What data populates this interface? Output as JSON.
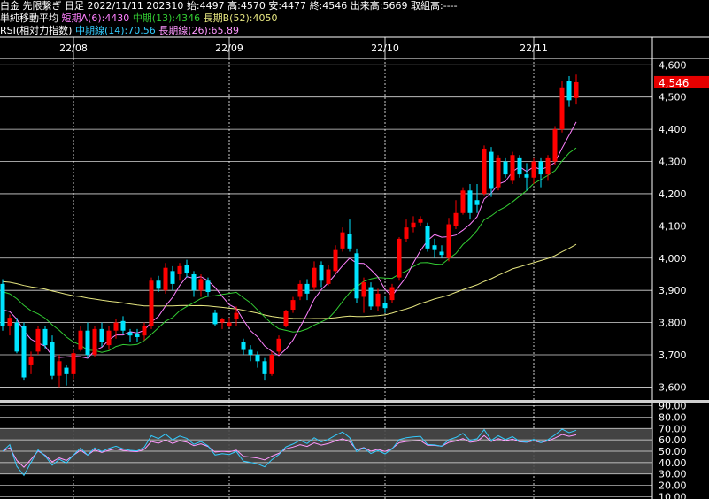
{
  "header": {
    "instrument": "白金 先限繋ぎ 日足",
    "date": "2022/11/11",
    "contract": "202310",
    "open_label": "始:",
    "open": "4497",
    "high_label": "高:",
    "high": "4570",
    "low_label": "安:",
    "low": "4477",
    "close_label": "終:",
    "close": "4546",
    "volume_label": "出来高:",
    "volume": "5669",
    "oi_label": "取組高:",
    "oi": "----",
    "ma_title": "単純移動平均",
    "ma_short_label": "短期A(6):",
    "ma_short": "4430",
    "ma_mid_label": "中期(13):",
    "ma_mid": "4346",
    "ma_long_label": "長期B(52):",
    "ma_long": "4050",
    "rsi_title": "RSI(相対力指数)",
    "rsi_mid_label": "中期線(14):",
    "rsi_mid": "70.56",
    "rsi_long_label": "長期線(26):",
    "rsi_long": "65.89"
  },
  "colors": {
    "up": "#ff0000",
    "down": "#00e5ff",
    "ma_short": "#ff80ff",
    "ma_mid": "#33cc33",
    "ma_long": "#e6e680",
    "rsi_mid": "#33ccff",
    "rsi_long": "#ff99ff",
    "last_price_bg": "#e60000"
  },
  "chart_data": [
    {
      "type": "candlestick",
      "x_tick_labels": [
        "22/08",
        "22/09",
        "22/10",
        "22/11"
      ],
      "x_tick_index": [
        10,
        32,
        54,
        75
      ],
      "y_ticks": [
        3600,
        3700,
        3800,
        3900,
        4000,
        4100,
        4200,
        4300,
        4400,
        4500,
        4600
      ],
      "y_tick_labels": [
        "3,600",
        "3,700",
        "3,800",
        "3,900",
        "4,000",
        "4,100",
        "4,200",
        "4,300",
        "4,400",
        "4,500",
        "4,600"
      ],
      "ylim": [
        3560,
        4620
      ],
      "last_price": 4546,
      "last_price_label": "4,546",
      "candles": [
        {
          "o": 3920,
          "h": 3935,
          "l": 3775,
          "c": 3790
        },
        {
          "o": 3790,
          "h": 3825,
          "l": 3760,
          "c": 3815
        },
        {
          "o": 3800,
          "h": 3815,
          "l": 3705,
          "c": 3710
        },
        {
          "o": 3790,
          "h": 3800,
          "l": 3620,
          "c": 3630
        },
        {
          "o": 3670,
          "h": 3710,
          "l": 3640,
          "c": 3695
        },
        {
          "o": 3710,
          "h": 3790,
          "l": 3700,
          "c": 3780
        },
        {
          "o": 3780,
          "h": 3790,
          "l": 3720,
          "c": 3730
        },
        {
          "o": 3740,
          "h": 3760,
          "l": 3625,
          "c": 3635
        },
        {
          "o": 3635,
          "h": 3700,
          "l": 3600,
          "c": 3680
        },
        {
          "o": 3660,
          "h": 3670,
          "l": 3605,
          "c": 3640
        },
        {
          "o": 3640,
          "h": 3715,
          "l": 3625,
          "c": 3705
        },
        {
          "o": 3715,
          "h": 3790,
          "l": 3710,
          "c": 3775
        },
        {
          "o": 3775,
          "h": 3800,
          "l": 3690,
          "c": 3700
        },
        {
          "o": 3700,
          "h": 3790,
          "l": 3695,
          "c": 3780
        },
        {
          "o": 3780,
          "h": 3800,
          "l": 3725,
          "c": 3740
        },
        {
          "o": 3730,
          "h": 3790,
          "l": 3715,
          "c": 3775
        },
        {
          "o": 3775,
          "h": 3810,
          "l": 3750,
          "c": 3800
        },
        {
          "o": 3805,
          "h": 3820,
          "l": 3765,
          "c": 3775
        },
        {
          "o": 3770,
          "h": 3780,
          "l": 3740,
          "c": 3760
        },
        {
          "o": 3765,
          "h": 3780,
          "l": 3740,
          "c": 3755
        },
        {
          "o": 3760,
          "h": 3800,
          "l": 3745,
          "c": 3790
        },
        {
          "o": 3790,
          "h": 3940,
          "l": 3780,
          "c": 3930
        },
        {
          "o": 3930,
          "h": 3945,
          "l": 3895,
          "c": 3905
        },
        {
          "o": 3900,
          "h": 3985,
          "l": 3890,
          "c": 3970
        },
        {
          "o": 3960,
          "h": 3975,
          "l": 3900,
          "c": 3920
        },
        {
          "o": 3950,
          "h": 3985,
          "l": 3930,
          "c": 3975
        },
        {
          "o": 3980,
          "h": 3995,
          "l": 3940,
          "c": 3955
        },
        {
          "o": 3950,
          "h": 3960,
          "l": 3880,
          "c": 3900
        },
        {
          "o": 3900,
          "h": 3950,
          "l": 3880,
          "c": 3935
        },
        {
          "o": 3930,
          "h": 3940,
          "l": 3880,
          "c": 3895
        },
        {
          "o": 3830,
          "h": 3840,
          "l": 3790,
          "c": 3795
        },
        {
          "o": 3800,
          "h": 3815,
          "l": 3780,
          "c": 3810
        },
        {
          "o": 3790,
          "h": 3815,
          "l": 3785,
          "c": 3800
        },
        {
          "o": 3810,
          "h": 3850,
          "l": 3790,
          "c": 3830
        },
        {
          "o": 3740,
          "h": 3750,
          "l": 3700,
          "c": 3715
        },
        {
          "o": 3715,
          "h": 3730,
          "l": 3680,
          "c": 3700
        },
        {
          "o": 3700,
          "h": 3710,
          "l": 3660,
          "c": 3680
        },
        {
          "o": 3680,
          "h": 3690,
          "l": 3620,
          "c": 3640
        },
        {
          "o": 3640,
          "h": 3710,
          "l": 3635,
          "c": 3700
        },
        {
          "o": 3710,
          "h": 3760,
          "l": 3700,
          "c": 3750
        },
        {
          "o": 3790,
          "h": 3840,
          "l": 3785,
          "c": 3835
        },
        {
          "o": 3840,
          "h": 3880,
          "l": 3830,
          "c": 3870
        },
        {
          "o": 3880,
          "h": 3930,
          "l": 3870,
          "c": 3920
        },
        {
          "o": 3920,
          "h": 3935,
          "l": 3870,
          "c": 3890
        },
        {
          "o": 3910,
          "h": 3990,
          "l": 3900,
          "c": 3970
        },
        {
          "o": 3980,
          "h": 3990,
          "l": 3910,
          "c": 3930
        },
        {
          "o": 3920,
          "h": 3980,
          "l": 3915,
          "c": 3965
        },
        {
          "o": 3960,
          "h": 4040,
          "l": 3950,
          "c": 4025
        },
        {
          "o": 4030,
          "h": 4095,
          "l": 4020,
          "c": 4080
        },
        {
          "o": 4075,
          "h": 4120,
          "l": 4020,
          "c": 4030
        },
        {
          "o": 4015,
          "h": 4030,
          "l": 3860,
          "c": 3875
        },
        {
          "o": 3880,
          "h": 3940,
          "l": 3830,
          "c": 3925
        },
        {
          "o": 3910,
          "h": 3925,
          "l": 3840,
          "c": 3850
        },
        {
          "o": 3850,
          "h": 3905,
          "l": 3835,
          "c": 3890
        },
        {
          "o": 3860,
          "h": 3880,
          "l": 3830,
          "c": 3845
        },
        {
          "o": 3870,
          "h": 3920,
          "l": 3860,
          "c": 3910
        },
        {
          "o": 3940,
          "h": 4065,
          "l": 3930,
          "c": 4060
        },
        {
          "o": 4060,
          "h": 4120,
          "l": 4050,
          "c": 4095
        },
        {
          "o": 4095,
          "h": 4130,
          "l": 4080,
          "c": 4110
        },
        {
          "o": 4110,
          "h": 4130,
          "l": 4100,
          "c": 4120
        },
        {
          "o": 4100,
          "h": 4110,
          "l": 4020,
          "c": 4030
        },
        {
          "o": 4040,
          "h": 4060,
          "l": 4000,
          "c": 4025
        },
        {
          "o": 4020,
          "h": 4040,
          "l": 4000,
          "c": 4010
        },
        {
          "o": 4000,
          "h": 4125,
          "l": 3990,
          "c": 4105
        },
        {
          "o": 4100,
          "h": 4180,
          "l": 4090,
          "c": 4140
        },
        {
          "o": 4140,
          "h": 4220,
          "l": 4135,
          "c": 4210
        },
        {
          "o": 4210,
          "h": 4230,
          "l": 4120,
          "c": 4140
        },
        {
          "o": 4180,
          "h": 4230,
          "l": 4140,
          "c": 4165
        },
        {
          "o": 4200,
          "h": 4350,
          "l": 4195,
          "c": 4340
        },
        {
          "o": 4330,
          "h": 4345,
          "l": 4190,
          "c": 4215
        },
        {
          "o": 4220,
          "h": 4320,
          "l": 4210,
          "c": 4310
        },
        {
          "o": 4300,
          "h": 4310,
          "l": 4250,
          "c": 4260
        },
        {
          "o": 4240,
          "h": 4330,
          "l": 4230,
          "c": 4320
        },
        {
          "o": 4310,
          "h": 4320,
          "l": 4250,
          "c": 4260
        },
        {
          "o": 4260,
          "h": 4295,
          "l": 4210,
          "c": 4250
        },
        {
          "o": 4250,
          "h": 4310,
          "l": 4230,
          "c": 4300
        },
        {
          "o": 4300,
          "h": 4310,
          "l": 4220,
          "c": 4260
        },
        {
          "o": 4260,
          "h": 4320,
          "l": 4240,
          "c": 4310
        },
        {
          "o": 4300,
          "h": 4410,
          "l": 4290,
          "c": 4400
        },
        {
          "o": 4400,
          "h": 4550,
          "l": 4390,
          "c": 4530
        },
        {
          "o": 4550,
          "h": 4565,
          "l": 4470,
          "c": 4490
        },
        {
          "o": 4497,
          "h": 4570,
          "l": 4477,
          "c": 4546
        }
      ]
    },
    {
      "type": "line",
      "y_tick_labels": [
        "90.00",
        "80.00",
        "70.00",
        "60.00",
        "50.00",
        "40.00",
        "30.00",
        "20.00",
        "10.00"
      ],
      "y_ticks": [
        90,
        80,
        70,
        60,
        50,
        40,
        30,
        20,
        10
      ],
      "ylim": [
        8,
        92
      ],
      "band": [
        30,
        70
      ]
    }
  ]
}
